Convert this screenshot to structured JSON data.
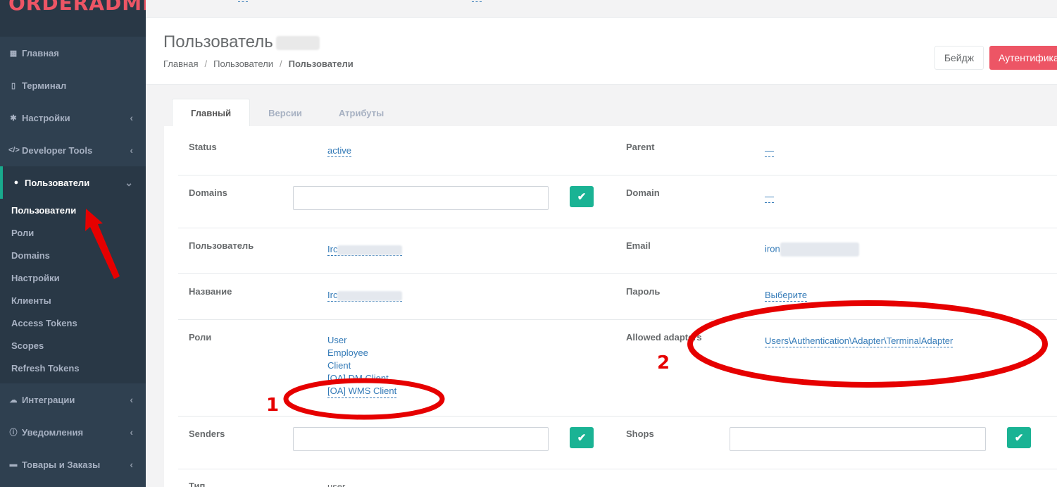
{
  "sidebar": {
    "logo": "ORDERADMIN",
    "items": [
      {
        "label": "Главная",
        "icon": "grid-icon"
      },
      {
        "label": "Терминал",
        "icon": "terminal-icon"
      },
      {
        "label": "Настройки",
        "icon": "gear-icon"
      },
      {
        "label": "Developer Tools",
        "icon": "code-icon"
      },
      {
        "label": "Пользователи",
        "icon": "user-icon"
      },
      {
        "label": "Интеграции",
        "icon": "cloud-icon"
      },
      {
        "label": "Уведомления",
        "icon": "info-icon"
      },
      {
        "label": "Товары и Заказы",
        "icon": "truck-icon"
      }
    ],
    "sub_items": [
      "Пользователи",
      "Роли",
      "Domains",
      "Настройки",
      "Клиенты",
      "Access Tokens",
      "Scopes",
      "Refresh Tokens"
    ]
  },
  "header": {
    "title": "Пользователь",
    "breadcrumb": [
      "Главная",
      "Пользователи",
      "Пользователи"
    ],
    "badge_button": "Бейдж",
    "auth_button": "Аутентифика"
  },
  "tabs": [
    "Главный",
    "Версии",
    "Атрибуты"
  ],
  "fields": {
    "status_label": "Status",
    "status_value": "active",
    "parent_label": "Parent",
    "parent_value": "—",
    "domains_label": "Domains",
    "domain_label": "Domain",
    "domain_value": "—",
    "user_label": "Пользователь",
    "user_value_prefix": "Irc",
    "email_label": "Email",
    "email_value_prefix": "iron",
    "name_label": "Название",
    "name_value_prefix": "Irc",
    "password_label": "Пароль",
    "password_value": "Выберите",
    "roles_label": "Роли",
    "roles": [
      "User",
      "Employee",
      "Client",
      "[OA] DM Client",
      "[OA] WMS Client"
    ],
    "adapters_label": "Allowed adapters",
    "adapters_value": "Users\\Authentication\\Adapter\\TerminalAdapter",
    "senders_label": "Senders",
    "shops_label": "Shops",
    "type_label": "Тип",
    "type_value": "user"
  },
  "annotations": {
    "marker_1": "1",
    "marker_2": "2",
    "color": "#e60000"
  },
  "colors": {
    "sidebar": "#2f4050",
    "accent": "#1ab394",
    "danger": "#ed5565",
    "link": "#337ab7"
  }
}
